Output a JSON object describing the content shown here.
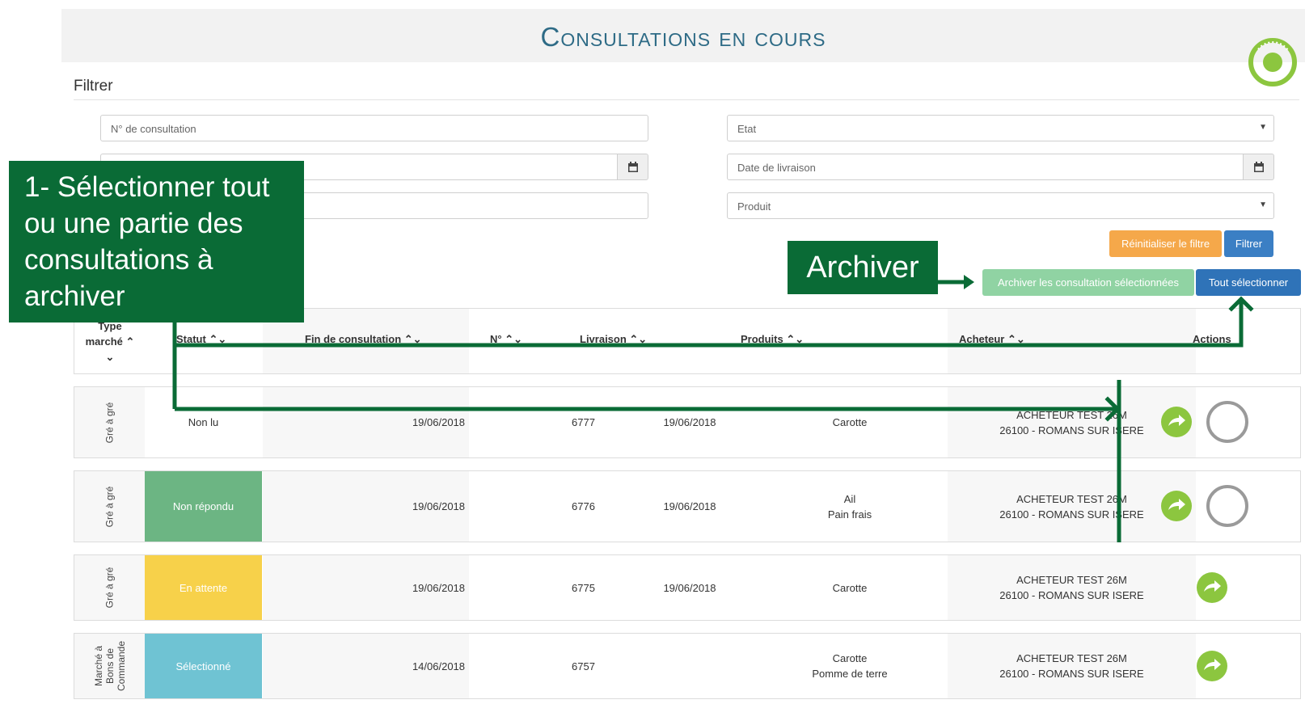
{
  "page": {
    "title": "Consultations en cours"
  },
  "filter": {
    "label": "Filtrer",
    "consultation_placeholder": "N° de consultation",
    "etat_placeholder": "Etat",
    "livraison_placeholder": "Date de livraison",
    "produit_placeholder": "Produit",
    "reset_label": "Réinitialiser le filtre",
    "filter_label": "Filtrer"
  },
  "actions": {
    "archive_label": "Archiver les consultation sélectionnées",
    "select_all_label": "Tout sélectionner"
  },
  "table": {
    "headers": {
      "type_line1": "Type",
      "type_line2": "marché",
      "statut": "Statut",
      "fin": "Fin de consultation",
      "num": "N°",
      "livraison": "Livraison",
      "produits": "Produits",
      "acheteur": "Acheteur",
      "actions": "Actions"
    },
    "rows": [
      {
        "type": "Gré à gré",
        "statut": "Non lu",
        "fin": "19/06/2018",
        "num": "6777",
        "livraison": "19/06/2018",
        "produits_1": "Carotte",
        "produits_2": "",
        "acheteur_1": "ACHETEUR TEST 26M",
        "acheteur_2": "26100 - ROMANS SUR ISERE"
      },
      {
        "type": "Gré à gré",
        "statut": "Non répondu",
        "fin": "19/06/2018",
        "num": "6776",
        "livraison": "19/06/2018",
        "produits_1": "Ail",
        "produits_2": "Pain frais",
        "acheteur_1": "ACHETEUR TEST 26M",
        "acheteur_2": "26100 - ROMANS SUR ISERE"
      },
      {
        "type": "Gré à gré",
        "statut": "En attente",
        "fin": "19/06/2018",
        "num": "6775",
        "livraison": "19/06/2018",
        "produits_1": "Carotte",
        "produits_2": "",
        "acheteur_1": "ACHETEUR TEST 26M",
        "acheteur_2": "26100 - ROMANS SUR ISERE"
      },
      {
        "type_1": "Marché à",
        "type_2": "Bons de",
        "type_3": "Commande",
        "statut": "Sélectionné",
        "fin": "14/06/2018",
        "num": "6757",
        "livraison": "",
        "produits_1": "Carotte",
        "produits_2": "Pomme de terre",
        "acheteur_1": "ACHETEUR TEST 26M",
        "acheteur_2": "26100 - ROMANS SUR ISERE"
      }
    ]
  },
  "annotations": {
    "step1_line1": "1- Sélectionner tout",
    "step1_line2": "ou une partie des",
    "step1_line3": "consultations à",
    "step1_line4": "archiver",
    "archiver": "Archiver"
  },
  "colors": {
    "accent_green": "#0a6b36",
    "status_non_repondu": "#6cb583",
    "status_en_attente": "#f7d14a",
    "status_selectionne": "#6fc3d3",
    "go_icon": "#8cc63f"
  }
}
